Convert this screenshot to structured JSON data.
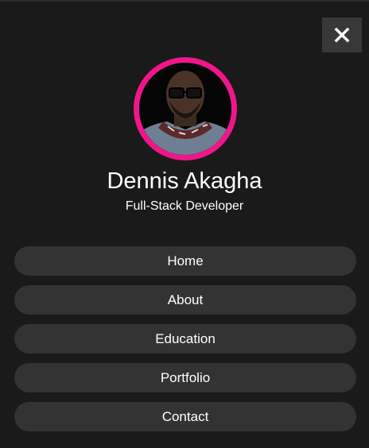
{
  "profile": {
    "name": "Dennis Akagha",
    "role": "Full-Stack Developer"
  },
  "close_button": {
    "icon": "close-icon"
  },
  "nav": {
    "items": [
      {
        "label": "Home"
      },
      {
        "label": "About"
      },
      {
        "label": "Education"
      },
      {
        "label": "Portfolio"
      },
      {
        "label": "Contact"
      }
    ]
  },
  "colors": {
    "background": "#1a1a1a",
    "accent_ring": "#f0168a",
    "nav_item_bg": "#333333",
    "close_bg": "#383838",
    "text": "#ffffff"
  }
}
